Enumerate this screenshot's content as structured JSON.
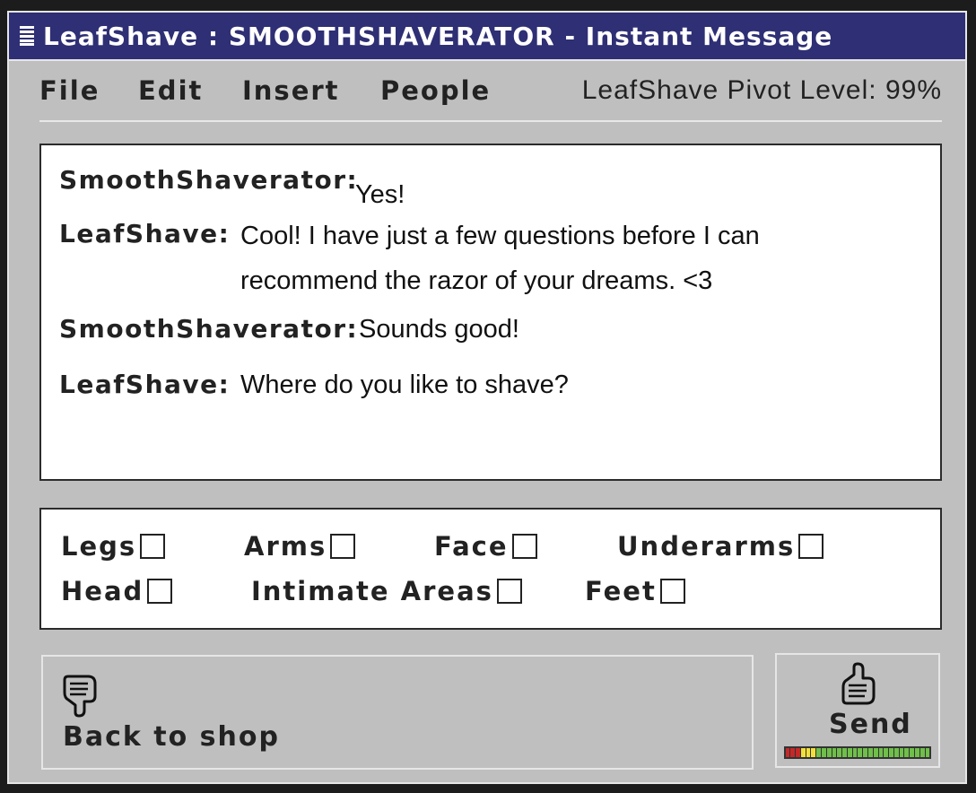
{
  "window": {
    "title": "LeafShave : SMOOTHSHAVERATOR - Instant Message"
  },
  "menu": {
    "items": [
      "File",
      "Edit",
      "Insert",
      "People"
    ],
    "pivot_level": "LeafShave Pivot Level: 99%"
  },
  "chat": {
    "messages": [
      {
        "sender": "SmoothShaverator:",
        "lines": [
          "Yes!"
        ]
      },
      {
        "sender": "LeafShave:",
        "lines": [
          "Cool! I have just a few questions before I can",
          "recommend the razor of your dreams. <3"
        ]
      },
      {
        "sender": "SmoothShaverator:",
        "lines": [
          "Sounds good!"
        ]
      },
      {
        "sender": "LeafShave:",
        "lines": [
          "Where do you like to shave?"
        ]
      }
    ]
  },
  "options": [
    {
      "label": "Legs",
      "checked": false
    },
    {
      "label": "Arms",
      "checked": false
    },
    {
      "label": "Face",
      "checked": false
    },
    {
      "label": "Underarms",
      "checked": false
    },
    {
      "label": "Head",
      "checked": false
    },
    {
      "label": "Intimate Areas",
      "checked": false
    },
    {
      "label": "Feet",
      "checked": false
    }
  ],
  "buttons": {
    "back_label": "Back to shop",
    "back_icon": "thumbs-down-icon",
    "send_label": "Send",
    "send_icon": "thumbs-up-icon",
    "meter_colors": [
      "#c62828",
      "#f2e03a",
      "#6fbf4a"
    ]
  },
  "colors": {
    "titlebar": "#2e2f74",
    "window": "#bfbfbf"
  }
}
